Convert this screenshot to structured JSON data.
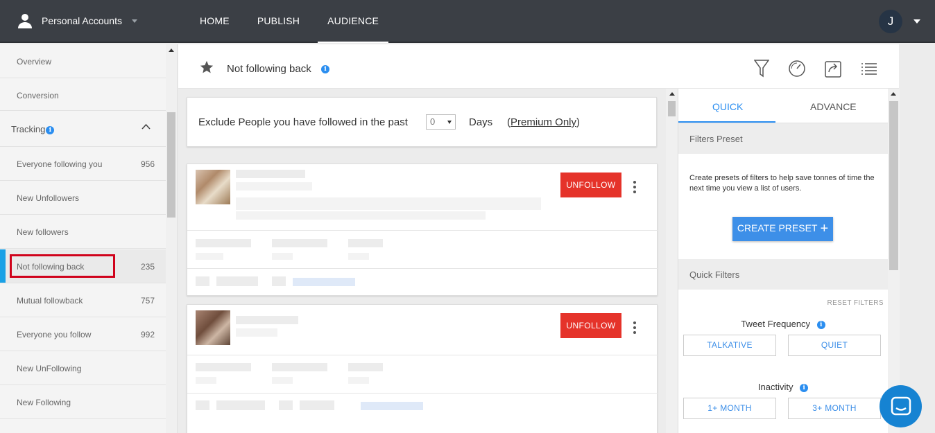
{
  "account": {
    "name": "Personal Accounts"
  },
  "nav": {
    "tabs": [
      {
        "label": "HOME"
      },
      {
        "label": "PUBLISH"
      },
      {
        "label": "AUDIENCE"
      }
    ],
    "active": "AUDIENCE"
  },
  "user": {
    "initial": "J"
  },
  "sidebar": {
    "top_items": [
      {
        "label": "Overview"
      },
      {
        "label": "Conversion"
      }
    ],
    "section": {
      "label": "Tracking"
    },
    "items": [
      {
        "label": "Everyone following you",
        "count": "956"
      },
      {
        "label": "New Unfollowers",
        "count": ""
      },
      {
        "label": "New followers",
        "count": ""
      },
      {
        "label": "Not following back",
        "count": "235"
      },
      {
        "label": "Mutual followback",
        "count": "757"
      },
      {
        "label": "Everyone you follow",
        "count": "992"
      },
      {
        "label": "New UnFollowing",
        "count": ""
      },
      {
        "label": "New Following",
        "count": ""
      }
    ]
  },
  "page": {
    "title": "Not following back"
  },
  "exclude": {
    "text": "Exclude People you have followed in the past",
    "days_value": "0",
    "days_label": "Days",
    "premium_open": "(",
    "premium_link": "Premium Only",
    "premium_close": ")"
  },
  "cards": [
    {
      "button": "UNFOLLOW"
    },
    {
      "button": "UNFOLLOW"
    }
  ],
  "filters": {
    "tabs": [
      {
        "label": "QUICK"
      },
      {
        "label": "ADVANCE"
      }
    ],
    "preset_header": "Filters Preset",
    "preset_desc": "Create presets of filters to help save tonnes of time the next time you view a list of users.",
    "create_label": "CREATE PRESET",
    "quick_header": "Quick Filters",
    "reset_label": "RESET FILTERS",
    "tweet_frequency": {
      "label": "Tweet Frequency",
      "options": [
        "TALKATIVE",
        "QUIET"
      ]
    },
    "inactivity": {
      "label": "Inactivity",
      "options": [
        "1+ MONTH",
        "3+ MONTH"
      ]
    }
  },
  "colors": {
    "accent": "#2b8ef0",
    "danger": "#e5332a",
    "topbar": "#3b3f45",
    "active_bar": "#1aa1e6",
    "highlight": "#d0021b"
  }
}
